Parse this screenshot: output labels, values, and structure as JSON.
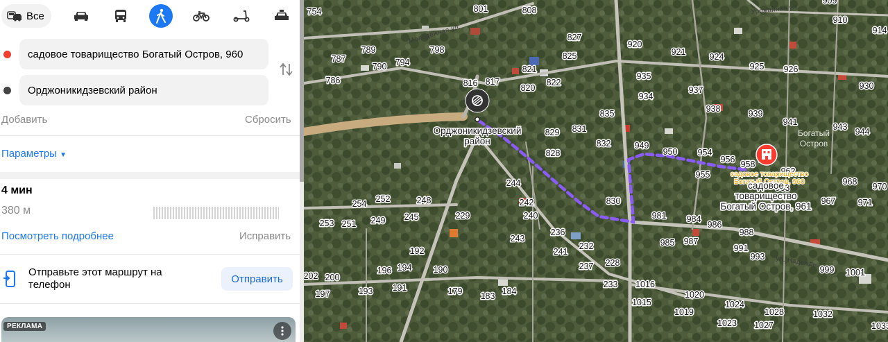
{
  "modes": {
    "all_label": "Все",
    "items": [
      "car-icon",
      "bus-icon",
      "walk-icon",
      "bike-icon",
      "scooter-icon",
      "taxi-icon"
    ],
    "active": "walk-icon",
    "accent": "#1c78f3"
  },
  "route": {
    "from": "садовое товарищество Богатый Остров, 960",
    "to": "Орджоникидзевский район",
    "from_dot_color": "#f04030",
    "to_dot_color": "#444444",
    "add_label": "Добавить",
    "reset_label": "Сбросить"
  },
  "params_label": "Параметры",
  "summary": {
    "time": "4 мин",
    "distance": "380 м",
    "details_label": "Посмотреть подробнее",
    "fix_label": "Исправить"
  },
  "send": {
    "text": "Отправьте этот маршрут на телефон",
    "button": "Отправить"
  },
  "ad": {
    "badge": "РЕКЛАМА"
  },
  "map": {
    "start_label": "Орджоникидзевский район",
    "dest_label_orange": "садовое товарищество Богатый Остров, 960",
    "dest_label": "садовое товарищество Богатый Остров, 961",
    "area_name": "Богатый Остров",
    "streets": [
      "Молодёжная ул.",
      "ул. Надежды",
      "Урожайная ул."
    ],
    "route_color": "#8a5cf5",
    "plots": [
      "754",
      "801",
      "808",
      "909",
      "910",
      "914",
      "827",
      "920",
      "921",
      "924",
      "925",
      "926",
      "930",
      "789",
      "798",
      "787",
      "790",
      "794",
      "825",
      "821",
      "822",
      "935",
      "934",
      "937",
      "938",
      "939",
      "786",
      "816",
      "817",
      "820",
      "835",
      "941",
      "943",
      "944",
      "829",
      "831",
      "832",
      "949",
      "950",
      "954",
      "956",
      "958",
      "828",
      "955",
      "968",
      "970",
      "244",
      "254",
      "252",
      "248",
      "242",
      "240",
      "830",
      "981",
      "984",
      "986",
      "967",
      "971",
      "253",
      "251",
      "249",
      "245",
      "229",
      "236",
      "232",
      "241",
      "988",
      "991",
      "993",
      "192",
      "196",
      "194",
      "190",
      "243",
      "237",
      "228",
      "985",
      "987",
      "999",
      "1001",
      "202",
      "200",
      "197",
      "193",
      "191",
      "179",
      "183",
      "184",
      "233",
      "1016",
      "1020",
      "1024",
      "1028",
      "1032",
      "1015",
      "1019",
      "1023",
      "1027",
      "1033",
      "962",
      "963"
    ]
  }
}
